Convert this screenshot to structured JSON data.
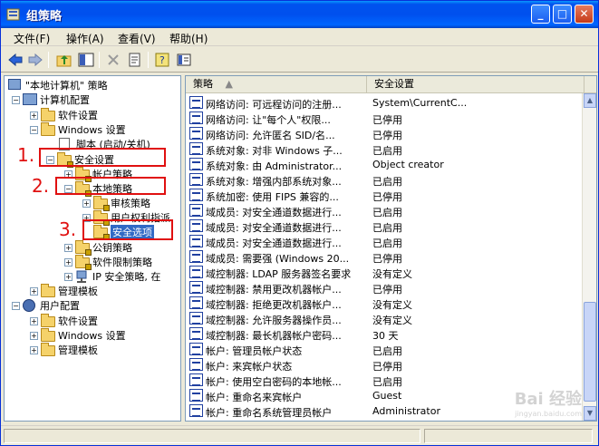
{
  "window": {
    "title": "组策略"
  },
  "menubar": [
    {
      "label": "文件(F)"
    },
    {
      "label": "操作(A)"
    },
    {
      "label": "查看(V)"
    },
    {
      "label": "帮助(H)"
    }
  ],
  "tree": [
    {
      "label": "\"本地计算机\" 策略",
      "icon": "policy-computer-icon"
    },
    {
      "label": "计算机配置",
      "icon": "computer-icon"
    },
    {
      "label": "软件设置",
      "icon": "folder-icon"
    },
    {
      "label": "Windows 设置",
      "icon": "folder-icon"
    },
    {
      "label": "脚本 (启动/关机)",
      "icon": "document-icon"
    },
    {
      "label": "安全设置",
      "icon": "lock-folder-icon"
    },
    {
      "label": "帐户策略",
      "icon": "lock-folder-icon"
    },
    {
      "label": "本地策略",
      "icon": "lock-folder-icon"
    },
    {
      "label": "审核策略",
      "icon": "lock-folder-icon"
    },
    {
      "label": "用户权利指派",
      "icon": "lock-folder-icon"
    },
    {
      "label": "安全选项",
      "icon": "lock-folder-icon"
    },
    {
      "label": "公钥策略",
      "icon": "lock-folder-icon"
    },
    {
      "label": "软件限制策略",
      "icon": "lock-folder-icon"
    },
    {
      "label": "IP 安全策略, 在",
      "icon": "network-icon"
    },
    {
      "label": "管理模板",
      "icon": "folder-icon"
    },
    {
      "label": "用户配置",
      "icon": "user-icon"
    },
    {
      "label": "软件设置",
      "icon": "folder-icon"
    },
    {
      "label": "Windows 设置",
      "icon": "folder-icon"
    },
    {
      "label": "管理模板",
      "icon": "folder-icon"
    }
  ],
  "list": {
    "columns": [
      "策略",
      "安全设置"
    ],
    "rows": [
      {
        "policy": "网络访问: 可远程访问的注册...",
        "setting": "System\\CurrentC..."
      },
      {
        "policy": "网络访问: 让\"每个人\"权限...",
        "setting": "已停用"
      },
      {
        "policy": "网络访问: 允许匿名 SID/名...",
        "setting": "已停用"
      },
      {
        "policy": "系统对象: 对非 Windows 子...",
        "setting": "已启用"
      },
      {
        "policy": "系统对象: 由 Administrator...",
        "setting": "Object creator"
      },
      {
        "policy": "系统对象: 增强内部系统对象...",
        "setting": "已启用"
      },
      {
        "policy": "系统加密: 使用 FIPS 兼容的...",
        "setting": "已停用"
      },
      {
        "policy": "域成员: 对安全通道数据进行...",
        "setting": "已启用"
      },
      {
        "policy": "域成员: 对安全通道数据进行...",
        "setting": "已启用"
      },
      {
        "policy": "域成员: 对安全通道数据进行...",
        "setting": "已启用"
      },
      {
        "policy": "域成员: 需要强 (Windows 20...",
        "setting": "已停用"
      },
      {
        "policy": "域控制器: LDAP 服务器签名要求",
        "setting": "没有定义"
      },
      {
        "policy": "域控制器: 禁用更改机器帐户...",
        "setting": "已停用"
      },
      {
        "policy": "域控制器: 拒绝更改机器帐户...",
        "setting": "没有定义"
      },
      {
        "policy": "域控制器: 允许服务器操作员...",
        "setting": "没有定义"
      },
      {
        "policy": "域控制器: 最长机器帐户密码...",
        "setting": "30 天"
      },
      {
        "policy": "帐户: 管理员帐户状态",
        "setting": "已启用"
      },
      {
        "policy": "帐户: 来宾帐户状态",
        "setting": "已停用"
      },
      {
        "policy": "帐户: 使用空白密码的本地帐...",
        "setting": "已启用"
      },
      {
        "policy": "帐户: 重命名来宾帐户",
        "setting": "Guest"
      },
      {
        "policy": "帐户: 重命名系统管理员帐户",
        "setting": "Administrator"
      }
    ]
  },
  "annotations": [
    "1.",
    "2.",
    "3."
  ],
  "watermark": {
    "text": "Bai 经验",
    "sub": "jingyan.baidu.com"
  },
  "colors": {
    "titlebar": "#0054e3",
    "selection": "#316ac5",
    "annotation": "#e01010"
  }
}
